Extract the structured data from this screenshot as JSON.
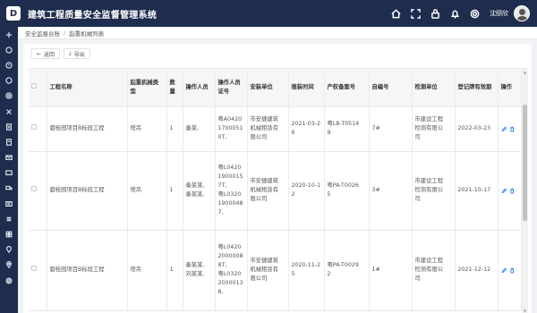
{
  "app": {
    "logo": "D",
    "title": "建筑工程质量安全监督管理系统"
  },
  "topbar": {
    "icons": [
      "home-icon",
      "fullscreen-icon",
      "lock-icon",
      "bell-icon",
      "settings-icon"
    ],
    "username": "沈颐欣"
  },
  "sidebar": {
    "icons": [
      "toggle-icon",
      "circle-icon",
      "circle-icon",
      "circle-icon",
      "circle-icon",
      "circle-icon",
      "document-icon",
      "document-icon",
      "envelope-icon",
      "envelope-icon",
      "truck-icon",
      "id-card-icon",
      "id-card-icon",
      "grid-icon",
      "location-icon",
      "location-icon",
      "gear-icon"
    ]
  },
  "breadcrumb": {
    "parent": "安全监督台账",
    "current": "起重机械列表"
  },
  "toolbar": {
    "back_label": "返回",
    "export_label": "导出"
  },
  "table": {
    "headers": [
      "",
      "工程名称",
      "起重机械类型",
      "数量",
      "操作人员",
      "操作人员证号",
      "安装单位",
      "报装时间",
      "产权备案号",
      "自编号",
      "检测单位",
      "登记牌有效期",
      "操作"
    ],
    "rows": [
      {
        "name": "碧桂园项目B标段工程",
        "type": "塔吊",
        "qty": "1",
        "operator": "秦某,",
        "cert": "粤A0420\n1700051\n0T,",
        "installer": "市安捷建筑\n机械租赁有\n限公司",
        "install_time": "2021-03-2\n6",
        "record": "粤LB-T0514\n9",
        "self_no": "7#",
        "inspector": "市建设工程\n检测有限公\n司",
        "expiry": "2022-03-23"
      },
      {
        "name": "碧桂园项目B标段工程",
        "type": "塔吊",
        "qty": "1",
        "operator": "秦某某,\n秦某某,",
        "cert": "粤L0420\n1900015\n7T,\n粤L0320\n1900048\n7,",
        "installer": "市安捷建筑\n机械租赁有\n限公司",
        "install_time": "2020-10-1\n2",
        "record": "粤PA-T0026\n5",
        "self_no": "3#",
        "inspector": "市建设工程\n检测有限公\n司",
        "expiry": "2021-10-17"
      },
      {
        "name": "碧桂园项目B标段工程",
        "type": "塔吊",
        "qty": "1",
        "operator": "秦某某,\n刘某某,",
        "cert": "粤L0420\n2000008\n8T,\n粤L0320\n2000013\n8,",
        "installer": "市安捷建筑\n机械租赁有\n限公司",
        "install_time": "2020-11-2\n5",
        "record": "粤PA-T0029\n2",
        "self_no": "1#",
        "inspector": "市建设工程\n检测有限公\n司",
        "expiry": "2021-12-12"
      }
    ]
  }
}
